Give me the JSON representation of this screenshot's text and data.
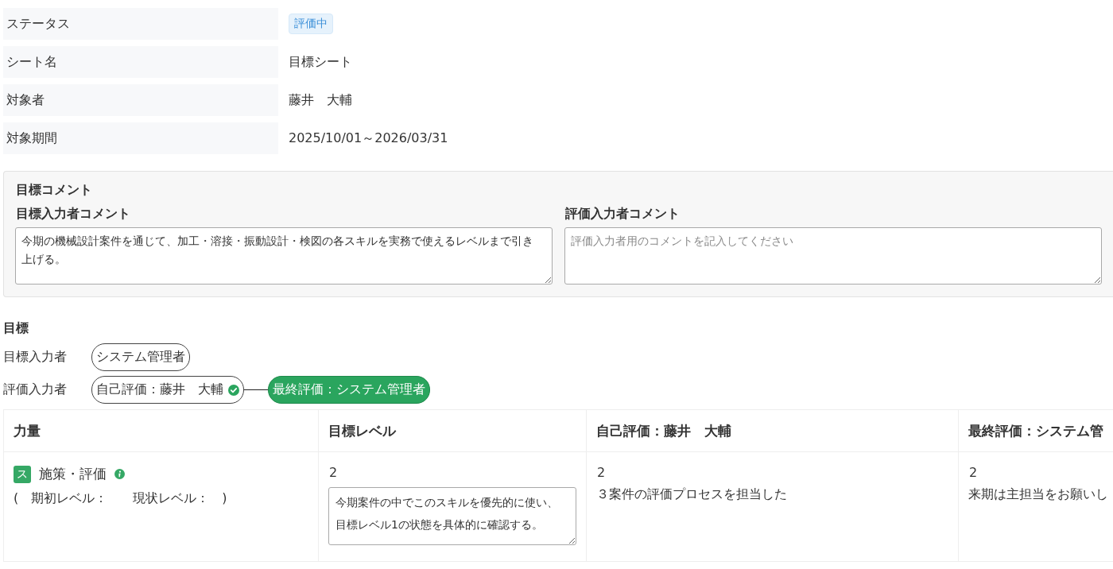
{
  "info_rows": [
    {
      "kind": "badge",
      "label": "ステータス",
      "value": "評価中"
    },
    {
      "kind": "text",
      "label": "シート名",
      "value": "目標シート"
    },
    {
      "kind": "text",
      "label": "対象者",
      "value": "藤井　大輔"
    },
    {
      "kind": "text",
      "label": "対象期間",
      "value": "2025/10/01～2026/03/31"
    }
  ],
  "goal_comment": {
    "title": "目標コメント",
    "fields": [
      {
        "label": "目標入力者コメント",
        "value": "今期の機械設計案件を通じて、加工・溶接・振動設計・検図の各スキルを実務で使えるレベルまで引き上げる。"
      },
      {
        "label": "評価入力者コメント",
        "placeholder": "評価入力者用のコメントを記入してください"
      }
    ]
  },
  "goal": {
    "title": "目標",
    "goal_input": {
      "label": "目標入力者",
      "person": "システム管理者"
    },
    "evaluators": {
      "label": "評価入力者",
      "steps": [
        {
          "label": "自己評価：藤井　大輔",
          "completed": true,
          "current": false
        },
        {
          "label": "最終評価：システム管理者",
          "completed": false,
          "current": true
        }
      ]
    }
  },
  "table": {
    "columns": [
      "力量",
      "目標レベル",
      "自己評価：藤井　大輔",
      "最終評価：システム管"
    ],
    "rows": [
      {
        "skill": {
          "tag": "ス",
          "name": "施策・評価",
          "levels": "(　期初レベル：　　現状レベル：　)"
        },
        "target": {
          "level": "2",
          "note": "今期案件の中でこのスキルを優先的に使い、目標レベル1の状態を具体的に確認する。"
        },
        "self": {
          "level": "2",
          "comment": "３案件の評価プロセスを担当した"
        },
        "final": {
          "level": "2",
          "comment": "来期は主担当をお願いし"
        }
      }
    ]
  }
}
